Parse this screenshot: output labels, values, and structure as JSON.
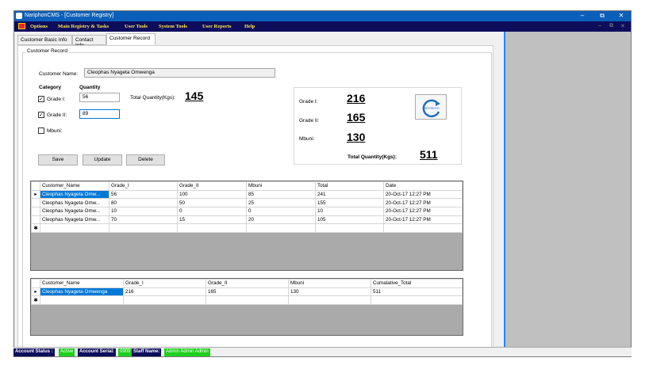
{
  "window": {
    "title": "NariphonCMS - [Customer Registry]"
  },
  "menu": [
    "Options",
    "Main Registry & Tasks",
    "User Tools",
    "System Tools",
    "User Reports",
    "Help"
  ],
  "tabs": [
    "Customer Basic Info",
    "Contact Info",
    "Customer Record"
  ],
  "record": {
    "group_title": "Customer Record",
    "customer_name_label": "Customer Name:",
    "customer_name_value": "Cleophas Nyageta Omwenga",
    "category_header": "Category",
    "quantity_header": "Quantity",
    "grade1_label": "Grade I:",
    "grade1_value": "56",
    "grade2_label": "Grade II:",
    "grade2_value": "89",
    "mbuni_label": "Mbuni:",
    "grade1_checked": true,
    "grade2_checked": true,
    "mbuni_checked": false,
    "total_label": "Total Quantity(Kgs):",
    "total_value": "145",
    "buttons": {
      "save": "Save",
      "update": "Update",
      "delete": "Delete"
    }
  },
  "summary": {
    "grade1_label": "Grade I:",
    "grade1_value": "216",
    "grade2_label": "Grade II:",
    "grade2_value": "165",
    "mbuni_label": "Mbuni:",
    "mbuni_value": "130",
    "total_label": "Total Quantity(Kgs):",
    "total_value": "511",
    "refresh_label": "REFRESH"
  },
  "grid1": {
    "columns": [
      "Customer_Name",
      "Grade_I",
      "Grade_II",
      "Mbuni",
      "Total",
      "Date"
    ],
    "rows": [
      [
        "Cleophas Nyageta Omw...",
        "56",
        "100",
        "85",
        "241",
        "20-Oct-17 12:27 PM"
      ],
      [
        "Cleophas Nyageta Omw...",
        "80",
        "50",
        "25",
        "155",
        "20-Oct-17 12:27 PM"
      ],
      [
        "Cleophas Nyageta Omw...",
        "10",
        "0",
        "0",
        "10",
        "20-Oct-17 12:27 PM"
      ],
      [
        "Cleophas Nyageta Omw...",
        "70",
        "15",
        "20",
        "105",
        "20-Oct-17 12:27 PM"
      ]
    ]
  },
  "grid2": {
    "columns": [
      "Customer_Name",
      "Grade_I",
      "Grade_II",
      "Mbuni",
      "Cumalative_Total"
    ],
    "rows": [
      [
        "Cleophas Nyageta Omwenga",
        "216",
        "165",
        "130",
        "511"
      ]
    ]
  },
  "status": {
    "account_status_label": "Account Status :",
    "account_status_value": "Active",
    "account_serial_label": "Account Serial:",
    "account_serial_value": "0909",
    "staff_name_label": "Staff Name:",
    "staff_name_value": "Admin Admin Admin"
  }
}
